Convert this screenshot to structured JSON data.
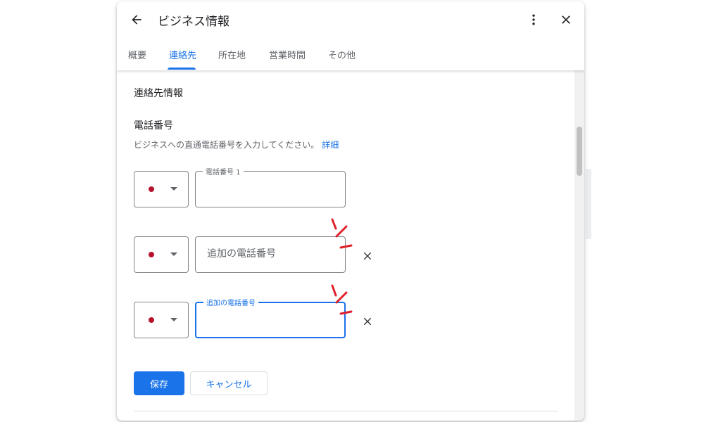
{
  "header": {
    "title": "ビジネス情報"
  },
  "tabs": [
    {
      "label": "概要"
    },
    {
      "label": "連絡先"
    },
    {
      "label": "所在地"
    },
    {
      "label": "営業時間"
    },
    {
      "label": "その他"
    }
  ],
  "active_tab": "連絡先",
  "section": {
    "title": "連絡先情報",
    "field_title": "電話番号",
    "help_text": "ビジネスへの直通電話番号を入力してください。",
    "help_link": "詳細"
  },
  "phones": [
    {
      "label": "電話番号 1",
      "value": "",
      "placeholder": ""
    },
    {
      "label": "",
      "value": "",
      "placeholder": "追加の電話番号"
    },
    {
      "label": "追加の電話番号",
      "value": "",
      "placeholder": ""
    }
  ],
  "buttons": {
    "save": "保存",
    "cancel": "キャンセル"
  },
  "colors": {
    "accent": "#1a73e8",
    "flag_dot": "#b8132e",
    "annotation": "#e0202a"
  },
  "icons": [
    "back-arrow-icon",
    "more-vert-icon",
    "close-icon",
    "dropdown-caret-icon",
    "remove-icon"
  ]
}
